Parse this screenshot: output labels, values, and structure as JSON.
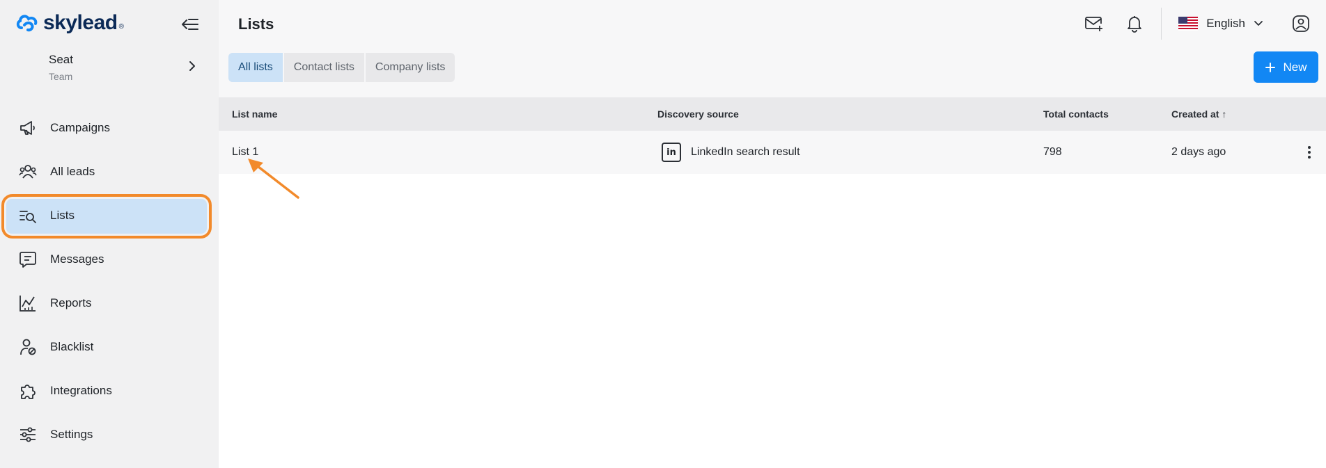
{
  "brand": {
    "name": "skylead",
    "reg": "®",
    "color": "#0b2a57",
    "accent": "#1287f4"
  },
  "seat": {
    "name": "Seat",
    "sub": "Team"
  },
  "nav": [
    {
      "label": "Campaigns",
      "icon": "megaphone-icon"
    },
    {
      "label": "All leads",
      "icon": "people-icon"
    },
    {
      "label": "Lists",
      "icon": "list-search-icon",
      "active": true
    },
    {
      "label": "Messages",
      "icon": "message-icon"
    },
    {
      "label": "Reports",
      "icon": "chart-icon"
    },
    {
      "label": "Blacklist",
      "icon": "user-block-icon"
    },
    {
      "label": "Integrations",
      "icon": "puzzle-icon"
    },
    {
      "label": "Settings",
      "icon": "sliders-icon"
    }
  ],
  "header": {
    "title": "Lists",
    "language": "English",
    "icons": [
      "mail-plus-icon",
      "bell-icon",
      "us-flag-icon",
      "chevron-down-icon",
      "user-circle-icon"
    ]
  },
  "tabs": [
    {
      "label": "All lists",
      "active": true
    },
    {
      "label": "Contact lists"
    },
    {
      "label": "Company lists"
    }
  ],
  "new_button": {
    "label": "New"
  },
  "table": {
    "columns": [
      "List name",
      "Discovery source",
      "Total contacts",
      "Created at ↑"
    ],
    "rows": [
      {
        "name": "List 1",
        "source_icon": "in",
        "source": "LinkedIn search result",
        "total": "798",
        "created": "2 days ago"
      }
    ]
  },
  "colors": {
    "highlight_ring": "#f28a2b",
    "active_bg": "#cce2f7",
    "annotation_arrow": "#f28a2b"
  }
}
